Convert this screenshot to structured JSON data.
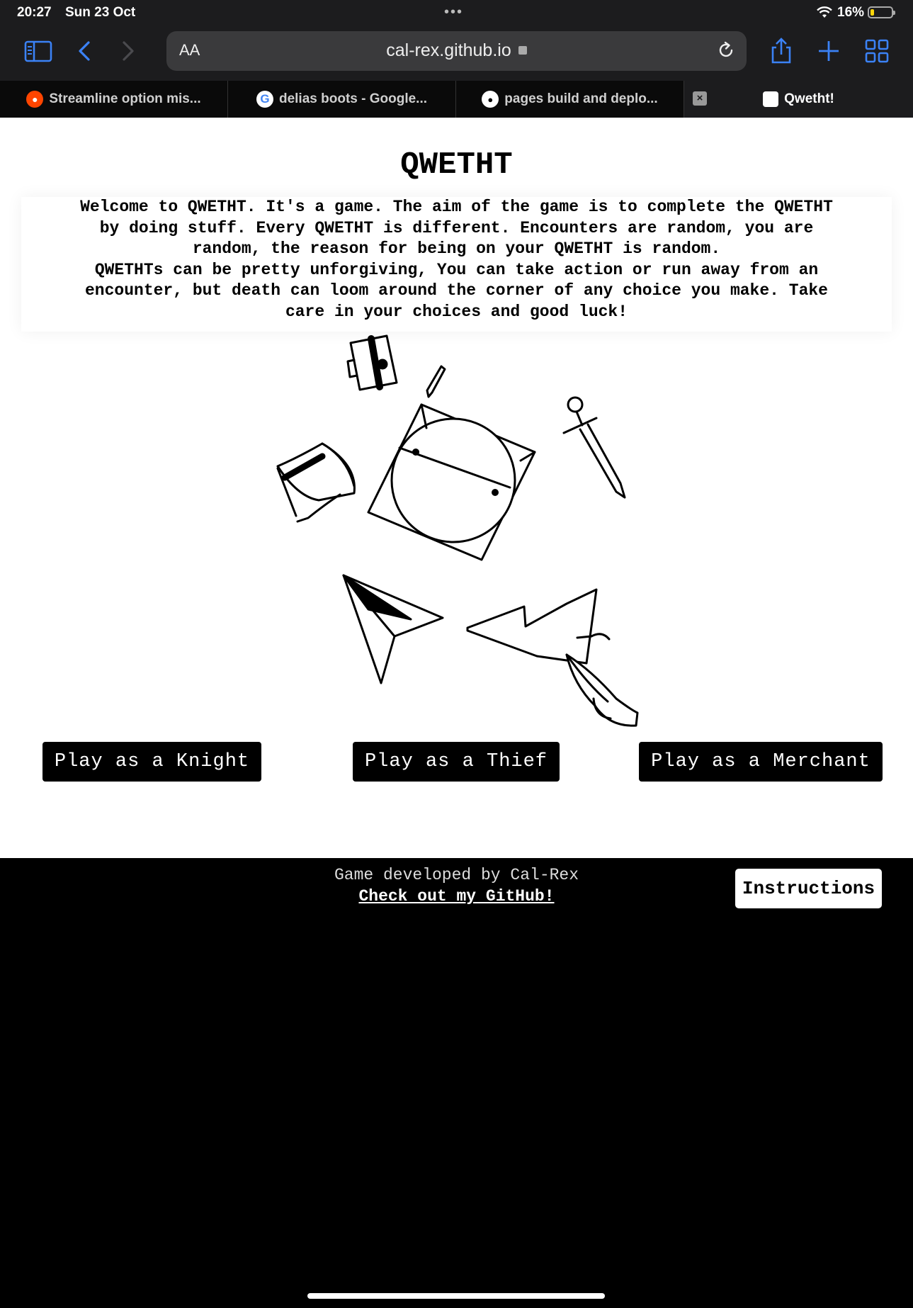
{
  "status_bar": {
    "time": "20:27",
    "date": "Sun 23 Oct",
    "battery": "16%"
  },
  "toolbar": {
    "aa_label": "AA",
    "url": "cal-rex.github.io"
  },
  "tabs": [
    {
      "label": "Streamline option mis...",
      "favicon": "reddit-icon"
    },
    {
      "label": "delias boots - Google...",
      "favicon": "google-icon"
    },
    {
      "label": "pages build and deplo...",
      "favicon": "github-icon"
    },
    {
      "label": "Qwetht!",
      "favicon": "site-icon",
      "active": true
    }
  ],
  "page": {
    "title": "QWETHT",
    "intro_lines": [
      "Welcome to QWETHT. It's a game. The aim of the game is to complete the QWETHT",
      "by doing stuff. Every QWETHT is different. Encounters are random, you are",
      "random, the reason for being on your QWETHT is random.",
      "QWETHTs can be pretty unforgiving, You can take action or run away from an",
      "encounter, but death can loom around the corner of any choice you make. Take",
      "care in your choices and good luck!"
    ],
    "buttons": {
      "knight": "Play as a Knight",
      "thief": "Play as a Thief",
      "merchant": "Play as a Merchant"
    }
  },
  "footer": {
    "credit": "Game developed by Cal-Rex",
    "github_link": "Check out my GitHub!",
    "instructions": "Instructions"
  },
  "colors": {
    "chrome_bg": "#1c1c1e",
    "url_bg": "#3a3a3c",
    "accent_blue": "#3b82f6",
    "page_bg": "#ffffff",
    "button_bg": "#000000"
  }
}
